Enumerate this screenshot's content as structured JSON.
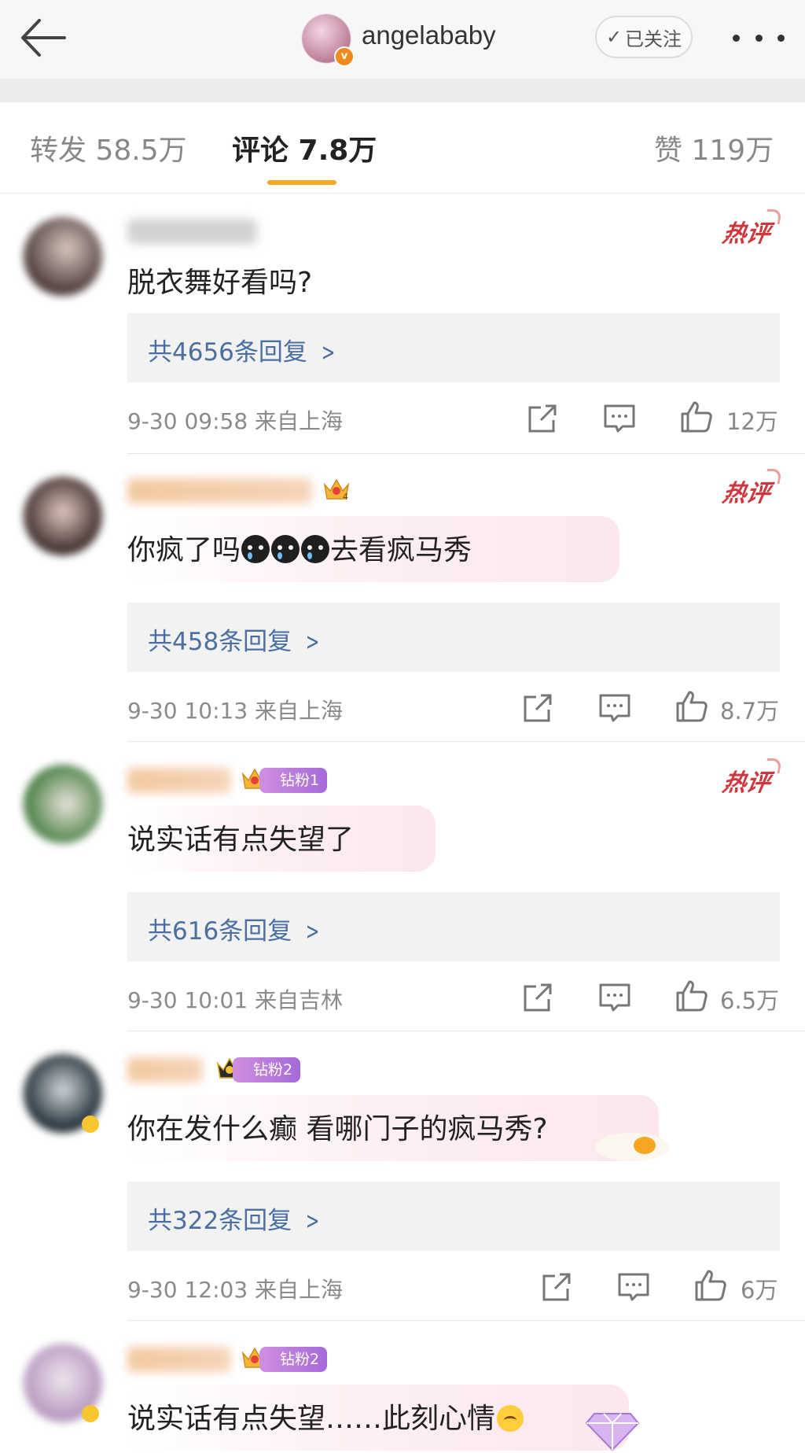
{
  "header": {
    "username": "angelababy",
    "verified_badge": "v",
    "follow_label": "已关注",
    "icons": {
      "back": "back-arrow-icon",
      "more": "more-dots-icon",
      "follow_check": "checkmark-icon"
    }
  },
  "tabs": [
    {
      "label": "转发 58.5万"
    },
    {
      "label": "评论 7.8万",
      "active": true
    },
    {
      "label": "赞 119万"
    }
  ],
  "colors": {
    "accent": "#f5a623",
    "link": "#4a6fa0",
    "hot": "#d0373d",
    "fan_badge": "#b47ad8"
  },
  "comments": [
    {
      "hot_label": "热评",
      "text": "脱衣舞好看吗?",
      "replies": "共4656条回复",
      "meta": "9-30 09:58  来自上海",
      "likes": "12万"
    },
    {
      "hot_label": "热评",
      "badge_level": "4",
      "text_before": "你疯了吗",
      "text_after": "去看疯马秀",
      "replies": "共458条回复",
      "meta": "9-30 10:13  来自上海",
      "likes": "8.7万"
    },
    {
      "hot_label": "热评",
      "badge_level": "3",
      "fan_badge": "钻粉1",
      "text": "说实话有点失望了",
      "replies": "共616条回复",
      "meta": "9-30 10:01  来自吉林",
      "likes": "6.5万"
    },
    {
      "fan_badge": "钻粉2",
      "text": "你在发什么癫 看哪门子的疯马秀?",
      "replies": "共322条回复",
      "meta": "9-30 12:03  来自上海",
      "likes": "6万"
    },
    {
      "badge_level": "6",
      "fan_badge": "钻粉2",
      "text": "说实话有点失望……此刻心情"
    }
  ]
}
